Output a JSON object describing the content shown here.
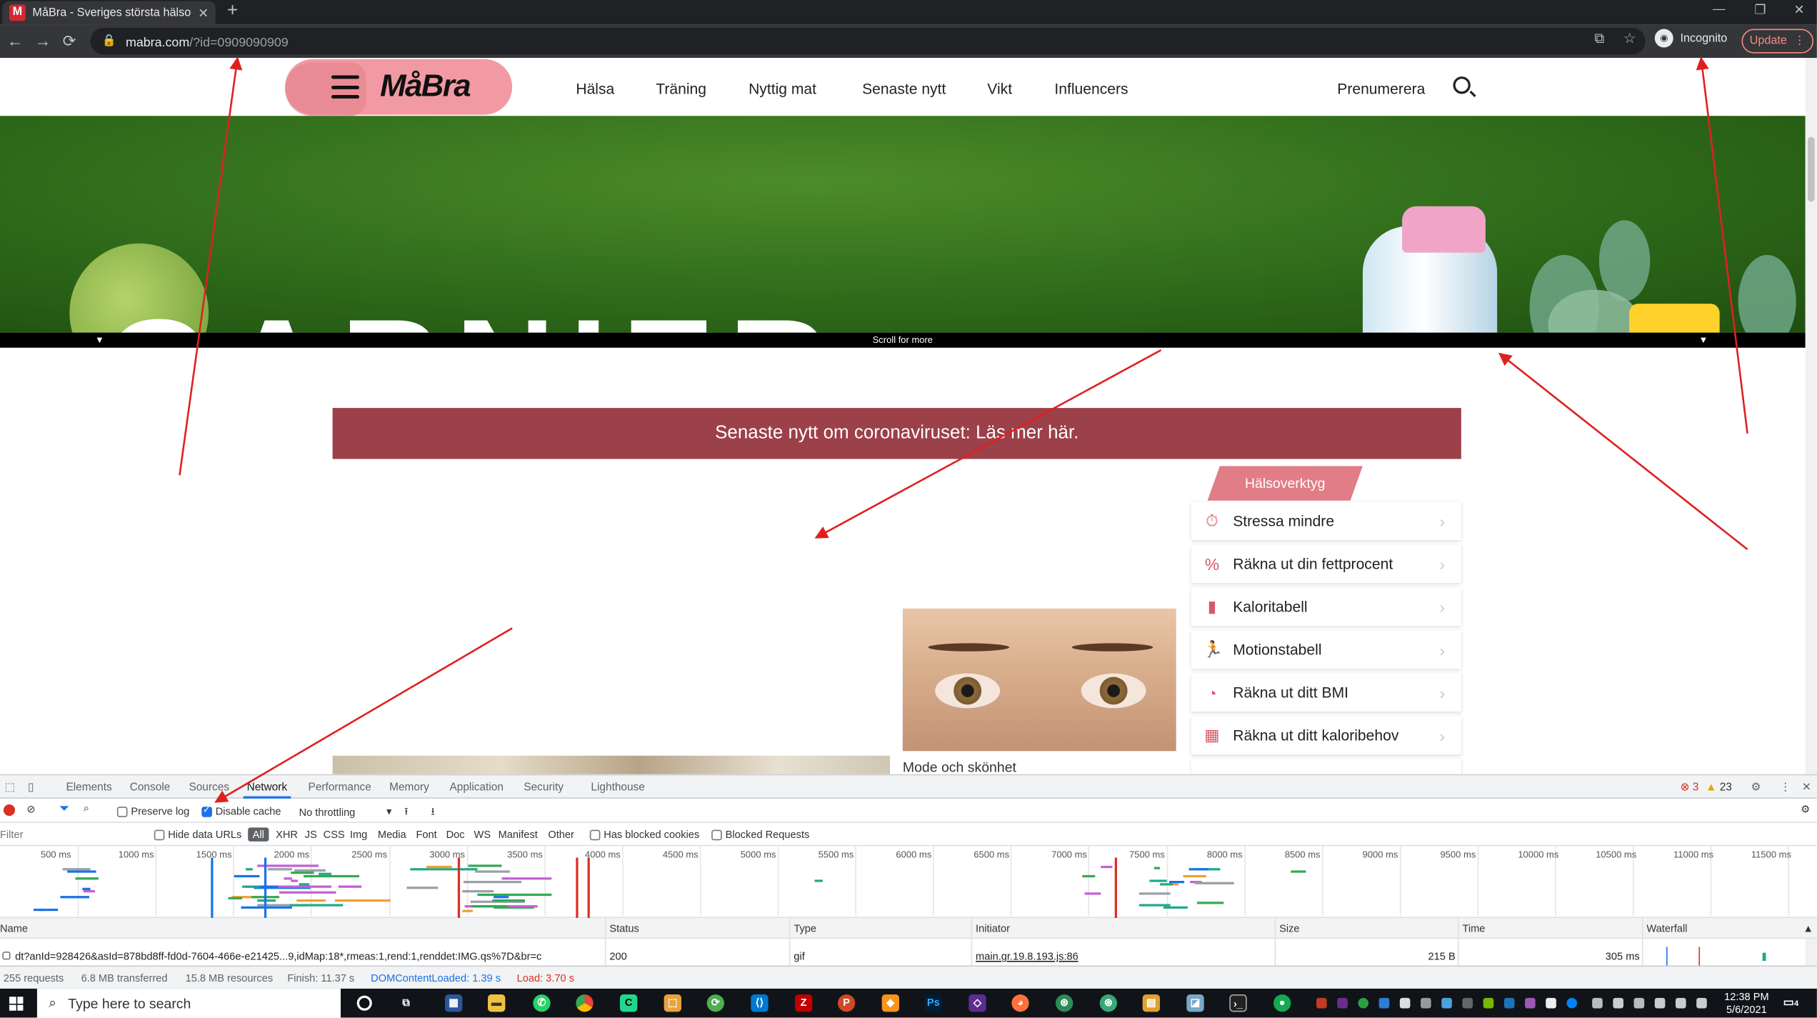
{
  "browser": {
    "tab_title": "MåBra - Sveriges största hälsotidning",
    "favicon_letter": "M",
    "tab_close": "✕",
    "new_tab": "+",
    "url_host": "mabra.com",
    "url_rest": "/?id=0909090909",
    "incognito_label": "Incognito",
    "update_label": "Update"
  },
  "site": {
    "logo": "MåBra",
    "nav": [
      "Hälsa",
      "Träning",
      "Nyttig mat",
      "Senaste nytt",
      "Vikt",
      "Influencers"
    ],
    "subscribe": "Prenumerera",
    "banner_word": "GARNIER",
    "scroll_for_more": "Scroll for more",
    "corona_banner": "Senaste nytt om coronaviruset: Läs mer här.",
    "tools_heading": "Hälsoverktyg",
    "tools": [
      {
        "label": "Stressa mindre",
        "icon": "stopwatch-icon",
        "glyph": "⏱"
      },
      {
        "label": "Räkna ut din fettprocent",
        "icon": "percent-icon",
        "glyph": "%"
      },
      {
        "label": "Kaloritabell",
        "icon": "bar-chart-icon",
        "glyph": "▮"
      },
      {
        "label": "Motionstabell",
        "icon": "runner-icon",
        "glyph": "🏃"
      },
      {
        "label": "Räkna ut ditt BMI",
        "icon": "gauge-icon",
        "glyph": "◔"
      },
      {
        "label": "Räkna ut ditt kaloribehov",
        "icon": "kcal-icon",
        "glyph": "▦"
      }
    ],
    "article_category": "Mode och skönhet"
  },
  "devtools": {
    "tabs": [
      "Elements",
      "Console",
      "Sources",
      "Network",
      "Performance",
      "Memory",
      "Application",
      "Security",
      "Lighthouse"
    ],
    "active_tab": "Network",
    "errors": "3",
    "warnings": "23",
    "preserve_log": "Preserve log",
    "disable_cache": "Disable cache",
    "throttling": "No throttling",
    "filter_placeholder": "Filter",
    "hide_data_urls": "Hide data URLs",
    "filter_types": [
      "All",
      "XHR",
      "JS",
      "CSS",
      "Img",
      "Media",
      "Font",
      "Doc",
      "WS",
      "Manifest",
      "Other"
    ],
    "has_blocked_cookies": "Has blocked cookies",
    "blocked_requests": "Blocked Requests",
    "timeline_ticks": [
      "500 ms",
      "1000 ms",
      "1500 ms",
      "2000 ms",
      "2500 ms",
      "3000 ms",
      "3500 ms",
      "4000 ms",
      "4500 ms",
      "5000 ms",
      "5500 ms",
      "6000 ms",
      "6500 ms",
      "7000 ms",
      "7500 ms",
      "8000 ms",
      "8500 ms",
      "9000 ms",
      "9500 ms",
      "10000 ms",
      "10500 ms",
      "11000 ms",
      "11500 ms"
    ],
    "columns": [
      "Name",
      "Status",
      "Type",
      "Initiator",
      "Size",
      "Time",
      "Waterfall"
    ],
    "row": {
      "name": "dt?anId=928426&asId=878bd8ff-fd0d-7604-466e-e21425...9,idMap:18*,rmeas:1,rend:1,renddet:IMG.qs%7D&br=c",
      "status": "200",
      "type": "gif",
      "initiator": "main.gr.19.8.193.js:86",
      "size": "215 B",
      "time": "305 ms"
    },
    "status_bar": {
      "requests": "255 requests",
      "transferred": "6.8 MB transferred",
      "resources": "15.8 MB resources",
      "finish": "Finish: 11.37 s",
      "dcl": "DOMContentLoaded: 1.39 s",
      "load": "Load: 3.70 s"
    }
  },
  "taskbar": {
    "search_placeholder": "Type here to search",
    "time": "12:38 PM",
    "date": "5/6/2021",
    "notifications": "4"
  },
  "colors": {
    "brand_pink": "#f29aa3",
    "corona_red": "#9c4049",
    "tools_pink": "#e07d86",
    "devtools_blue": "#1a73e8",
    "dcl_blue": "#1a73e8",
    "load_red": "#d93025",
    "annotation_red": "#e02020"
  }
}
